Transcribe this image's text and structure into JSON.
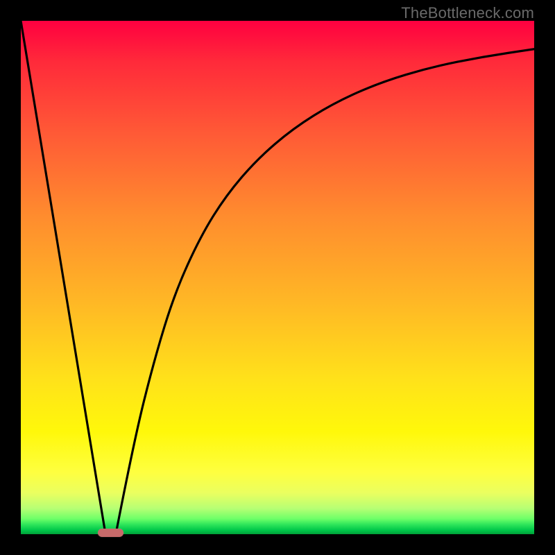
{
  "watermark": {
    "text": "TheBottleneck.com"
  },
  "colors": {
    "curve_stroke": "#000000",
    "marker_fill": "#c76a6a",
    "bg_border": "#000000"
  },
  "chart_data": {
    "type": "line",
    "title": "",
    "xlabel": "",
    "ylabel": "",
    "xlim": [
      0,
      100
    ],
    "ylim": [
      0,
      100
    ],
    "grid": false,
    "legend": false,
    "series": [
      {
        "name": "left-segment",
        "x": [
          0,
          16.5
        ],
        "y": [
          100,
          0
        ]
      },
      {
        "name": "right-curve",
        "x": [
          18.5,
          22,
          26,
          30,
          35,
          40,
          46,
          53,
          61,
          70,
          80,
          90,
          100
        ],
        "y": [
          0,
          18,
          34,
          47,
          58,
          66,
          73,
          79,
          84,
          88,
          91,
          93,
          94.5
        ]
      }
    ],
    "marker": {
      "x": 17.5,
      "y": 0,
      "width_pct": 4.9,
      "height_pct": 1.6
    },
    "gradient_stops": [
      {
        "pct": 0,
        "color": "#ff0040"
      },
      {
        "pct": 22,
        "color": "#ff5a36"
      },
      {
        "pct": 55,
        "color": "#ffb825"
      },
      {
        "pct": 80,
        "color": "#fff80a"
      },
      {
        "pct": 95,
        "color": "#b6ff74"
      },
      {
        "pct": 100,
        "color": "#00a038"
      }
    ]
  }
}
